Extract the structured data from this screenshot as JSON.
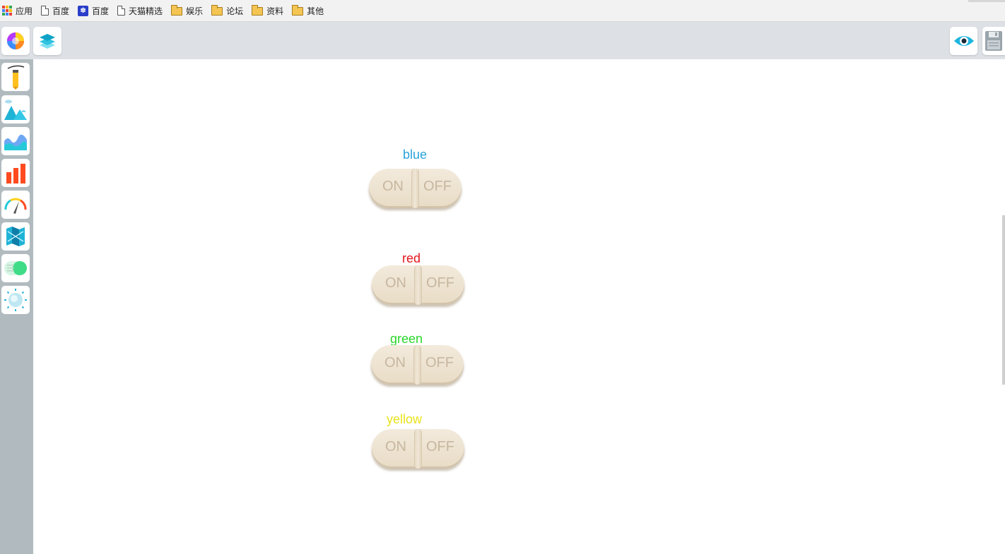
{
  "bookmarks": {
    "items": [
      {
        "label": "应用",
        "icon": "apps-grid-icon"
      },
      {
        "label": "百度",
        "icon": "page-icon"
      },
      {
        "label": "百度",
        "icon": "baidu-paw-icon"
      },
      {
        "label": "天猫精选",
        "icon": "page-icon"
      },
      {
        "label": "娱乐",
        "icon": "folder-icon"
      },
      {
        "label": "论坛",
        "icon": "folder-icon"
      },
      {
        "label": "资料",
        "icon": "folder-icon"
      },
      {
        "label": "其他",
        "icon": "folder-icon"
      }
    ]
  },
  "toolbar": {
    "left_icons": [
      "color-wheel-icon",
      "layers-icon"
    ],
    "right_icons": [
      "eye-preview-icon",
      "save-disk-icon"
    ]
  },
  "sidebar": {
    "icons": [
      "pen-tool-icon",
      "landscape-image-icon",
      "area-chart-icon",
      "bar-chart-icon",
      "gauge-icon",
      "map-icon",
      "toggle-switch-icon",
      "sun-light-icon"
    ]
  },
  "switches": [
    {
      "label": "blue",
      "color": "#29a3db",
      "on_text": "ON",
      "off_text": "OFF"
    },
    {
      "label": "red",
      "color": "#e2141c",
      "on_text": "ON",
      "off_text": "OFF"
    },
    {
      "label": "green",
      "color": "#2bd62b",
      "on_text": "ON",
      "off_text": "OFF"
    },
    {
      "label": "yellow",
      "color": "#e8e21a",
      "on_text": "ON",
      "off_text": "OFF"
    }
  ]
}
